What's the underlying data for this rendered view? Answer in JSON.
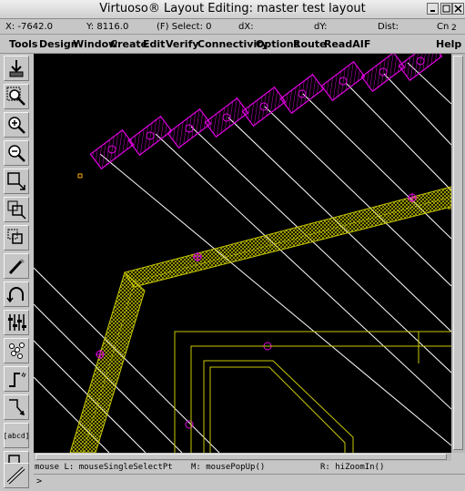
{
  "window": {
    "title": "Virtuoso® Layout Editing: master test layout",
    "corner_number": "2"
  },
  "status": {
    "x": "X: -7642.0",
    "y": "Y: 8116.0",
    "select": "(F) Select: 0",
    "dx": "dX:",
    "dy": "dY:",
    "dist": "Dist:",
    "cmd": "Cn"
  },
  "menu": {
    "tools": "Tools",
    "design": "Design",
    "window": "Window",
    "create": "Create",
    "edit": "Edit",
    "verify": "Verify",
    "connectivity": "Connectivity",
    "options": "Options",
    "route": "Route",
    "readaif": "ReadAIF",
    "help": "Help"
  },
  "toolbar": {
    "label_tool_text": "[abcd]",
    "icons": [
      "save-icon",
      "zoom-fit-icon",
      "zoom-in-icon",
      "zoom-out-icon",
      "stretch-icon",
      "copy-icon",
      "move-icon",
      "delete-icon",
      "undo-icon",
      "property-icon",
      "ruler-icon",
      "path-icon",
      "polygon-icon",
      "label-icon",
      "instance-icon",
      "measure-icon"
    ]
  },
  "mouse": {
    "left": "mouse L: mouseSingleSelectPt",
    "middle": "M: mousePopUp()",
    "right": "R: hiZoomIn()"
  },
  "command": {
    "prompt": ">"
  },
  "colors": {
    "canvas": "#000000",
    "metal": "#c8c800",
    "pad": "#e000e0",
    "wire": "#ffffff",
    "outline": "#c8c800",
    "panel": "#c6c6c6"
  }
}
